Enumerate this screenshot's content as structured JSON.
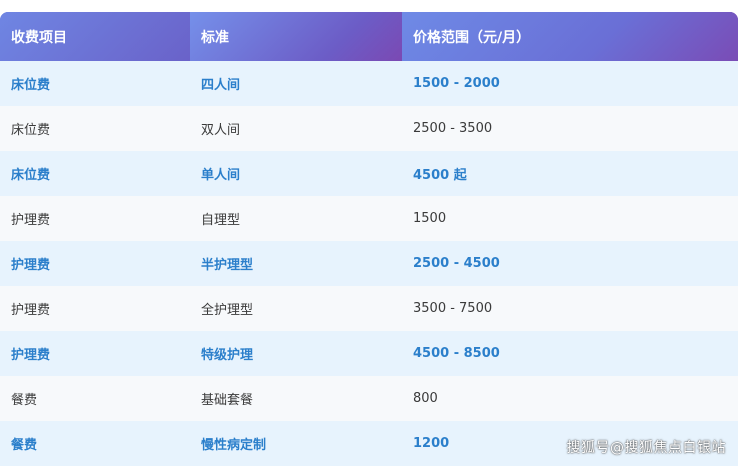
{
  "header": [
    "收费项目",
    "标准",
    "价格范围（元/月）"
  ],
  "rows": [
    {
      "item": "床位费",
      "standard": "四人间",
      "price": "1500 - 2000",
      "highlight": true
    },
    {
      "item": "床位费",
      "standard": "双人间",
      "price": "2500 - 3500",
      "highlight": false
    },
    {
      "item": "床位费",
      "standard": "单人间",
      "price": "4500 起",
      "highlight": true
    },
    {
      "item": "护理费",
      "standard": "自理型",
      "price": "1500",
      "highlight": false
    },
    {
      "item": "护理费",
      "standard": "半护理型",
      "price": "2500 - 4500",
      "highlight": true
    },
    {
      "item": "护理费",
      "standard": "全护理型",
      "price": "3500 - 7500",
      "highlight": false
    },
    {
      "item": "护理费",
      "standard": "特级护理",
      "price": "4500 - 8500",
      "highlight": true
    },
    {
      "item": "餐费",
      "standard": "基础套餐",
      "price": "800",
      "highlight": false
    },
    {
      "item": "餐费",
      "standard": "慢性病定制",
      "price": "1200",
      "highlight": true
    }
  ],
  "watermark": "搜狐号@搜狐焦点白银站",
  "colors": {
    "header_start": "#6f86e3",
    "header_end": "#7a4cb6",
    "highlight_row_bg": "#e7f3fd",
    "highlight_text": "#2b7fcb",
    "plain_row_bg": "#f7f9fb"
  }
}
